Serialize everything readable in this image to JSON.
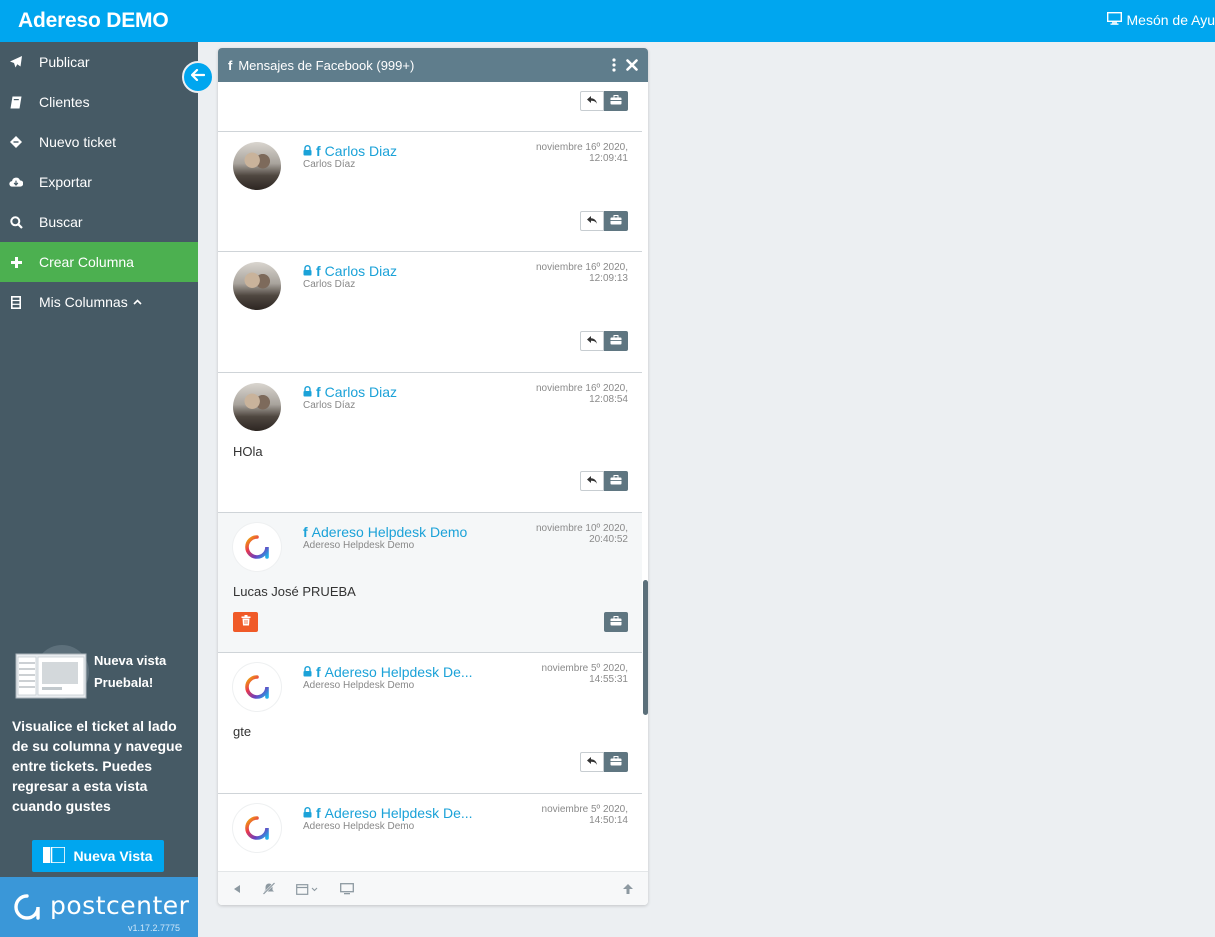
{
  "app": {
    "title": "Adereso DEMO",
    "help_desk": "Mesón de Ayu"
  },
  "sidebar": {
    "items": [
      {
        "label": "Publicar",
        "icon": "paper-plane-icon"
      },
      {
        "label": "Clientes",
        "icon": "book-icon"
      },
      {
        "label": "Nuevo ticket",
        "icon": "ticket-icon"
      },
      {
        "label": "Exportar",
        "icon": "cloud-download-icon"
      },
      {
        "label": "Buscar",
        "icon": "search-icon"
      },
      {
        "label": "Crear Columna",
        "icon": "plus-icon"
      },
      {
        "label": "Mis Columnas",
        "icon": "columns-icon"
      }
    ],
    "promo": {
      "title_line1": "Nueva vista",
      "title_line2": "Pruebala!",
      "text": "Visualice el ticket al lado de su columna y navegue entre tickets. Puedes regresar a esta vista cuando gustes",
      "button": "Nueva Vista"
    },
    "footer": {
      "brand": "postcenter",
      "version": "v1.17.2.7775"
    }
  },
  "column": {
    "title": "Mensajes de Facebook (999+)",
    "messages": [
      {
        "sender": "Carlos Diaz",
        "subname": "Carlos Díaz",
        "date_line1": "noviembre 16º 2020,",
        "date_line2": "12:09:41",
        "text": ""
      },
      {
        "sender": "Carlos Diaz",
        "subname": "Carlos Díaz",
        "date_line1": "noviembre 16º 2020,",
        "date_line2": "12:09:13",
        "text": ""
      },
      {
        "sender": "Carlos Diaz",
        "subname": "Carlos Díaz",
        "date_line1": "noviembre 16º 2020,",
        "date_line2": "12:08:54",
        "text": "HOla"
      },
      {
        "sender": "Adereso Helpdesk Demo",
        "subname": "Adereso Helpdesk Demo",
        "date_line1": "noviembre 10º 2020,",
        "date_line2": "20:40:52",
        "text": "Lucas José PRUEBA"
      },
      {
        "sender": "Adereso Helpdesk De...",
        "subname": "Adereso Helpdesk Demo",
        "date_line1": "noviembre 5º 2020,",
        "date_line2": "14:55:31",
        "text": "gte"
      },
      {
        "sender": "Adereso Helpdesk De...",
        "subname": "Adereso Helpdesk Demo",
        "date_line1": "noviembre 5º 2020,",
        "date_line2": "14:50:14",
        "text": ""
      }
    ]
  },
  "colors": {
    "topbar": "#00a6ef",
    "sidebar": "#465a65",
    "active": "#4cb050",
    "column_header": "#5f7d8c",
    "link": "#1ba2d8",
    "trash": "#f05a28"
  }
}
